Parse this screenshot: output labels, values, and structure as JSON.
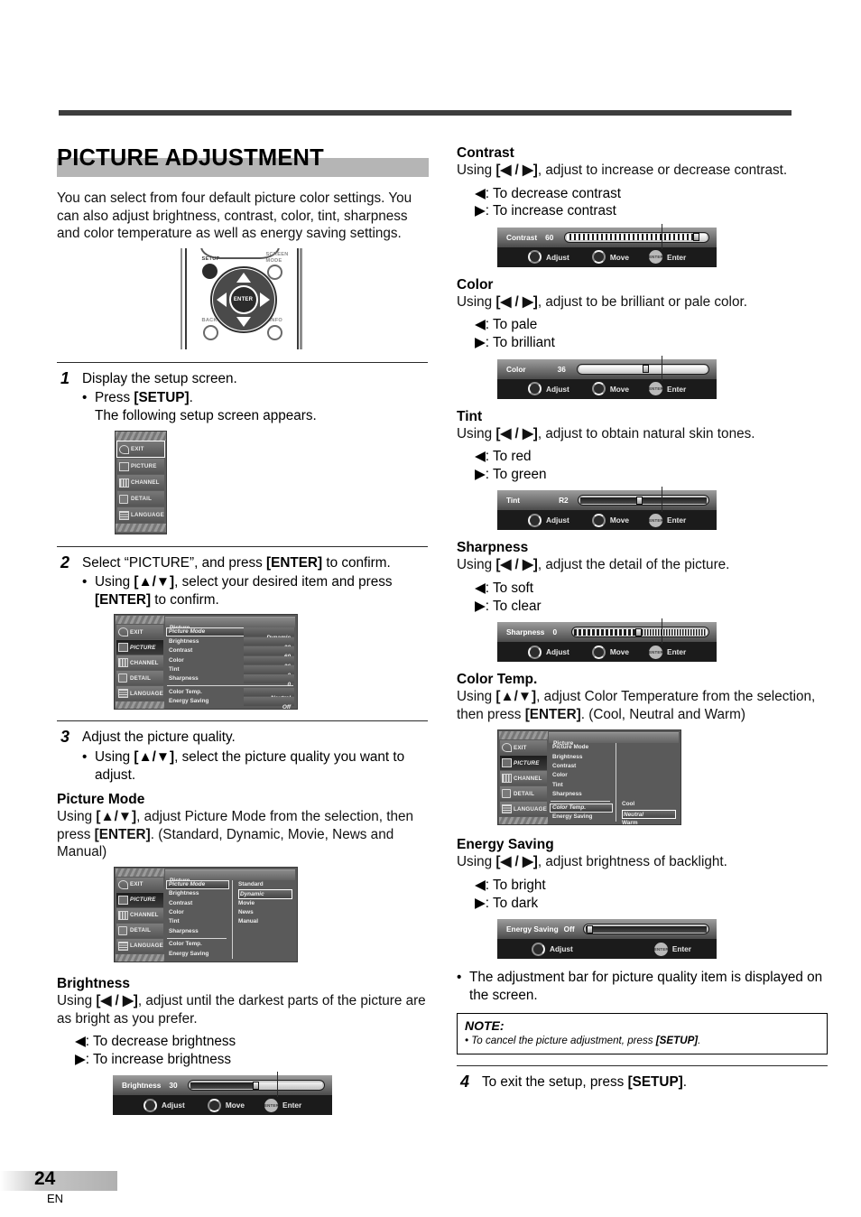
{
  "page": {
    "number": "24",
    "lang_code": "EN"
  },
  "title": "PICTURE ADJUSTMENT",
  "intro": "You can select from four default picture color settings. You can also adjust brightness, contrast, color, tint, sharpness and color temperature as well as energy saving settings.",
  "remote": {
    "setup_label": "SETUP",
    "screen_mode_label_1": "SCREEN",
    "screen_mode_label_2": "MODE",
    "back_label": "BACK",
    "info_label": "INFO",
    "enter_label": "ENTER"
  },
  "steps": [
    {
      "num": "1",
      "text": "Display the setup screen.",
      "bullets": [
        "Press [SETUP].",
        "The following setup screen appears."
      ]
    },
    {
      "num": "2",
      "text": "Select “PICTURE”, and press [ENTER] to confirm.",
      "bullets": [
        "Using [▲/▼], select your desired item and press [ENTER] to confirm."
      ]
    },
    {
      "num": "3",
      "text": "Adjust the picture quality.",
      "bullets": [
        "Using [▲/▼], select the picture quality you want to adjust."
      ]
    },
    {
      "num": "4",
      "text": "To exit the setup, press [SETUP]."
    }
  ],
  "setup_menu": {
    "items": [
      {
        "label": "EXIT",
        "icon": "exit-arrow-icon",
        "selected": true
      },
      {
        "label": "PICTURE",
        "icon": "picture-icon",
        "selected": false
      },
      {
        "label": "CHANNEL",
        "icon": "channel-bars-icon",
        "selected": false
      },
      {
        "label": "DETAIL",
        "icon": "detail-pages-icon",
        "selected": false
      },
      {
        "label": "LANGUAGE",
        "icon": "language-pencil-icon",
        "selected": false
      }
    ]
  },
  "picture_menu": {
    "header": "Picture",
    "rows": [
      {
        "label": "Picture Mode",
        "value": "Dynamic",
        "selected": true
      },
      {
        "label": "Brightness",
        "value": "30",
        "selected": false
      },
      {
        "label": "Contrast",
        "value": "60",
        "selected": false
      },
      {
        "label": "Color",
        "value": "36",
        "selected": false
      },
      {
        "label": "Tint",
        "value": "0",
        "selected": false
      },
      {
        "label": "Sharpness",
        "value": "0",
        "selected": false
      },
      {
        "label": "Color Temp.",
        "value": "Neutral",
        "selected": false
      },
      {
        "label": "Energy Saving",
        "value": "Off",
        "selected": false
      }
    ]
  },
  "picture_mode_menu": {
    "header": "Picture",
    "rows": [
      {
        "label": "Picture Mode",
        "selected": true
      },
      {
        "label": "Brightness",
        "selected": false
      },
      {
        "label": "Contrast",
        "selected": false
      },
      {
        "label": "Color",
        "selected": false
      },
      {
        "label": "Tint",
        "selected": false
      },
      {
        "label": "Sharpness",
        "selected": false
      },
      {
        "label": "Color Temp.",
        "selected": false
      },
      {
        "label": "Energy Saving",
        "selected": false
      }
    ],
    "options": [
      {
        "label": "Standard",
        "selected": false
      },
      {
        "label": "Dynamic",
        "selected": true
      },
      {
        "label": "Movie",
        "selected": false
      },
      {
        "label": "News",
        "selected": false
      },
      {
        "label": "Manual",
        "selected": false
      }
    ]
  },
  "color_temp_menu": {
    "header": "Picture",
    "rows": [
      {
        "label": "Picture Mode",
        "selected": false
      },
      {
        "label": "Brightness",
        "selected": false
      },
      {
        "label": "Contrast",
        "selected": false
      },
      {
        "label": "Color",
        "selected": false
      },
      {
        "label": "Tint",
        "selected": false
      },
      {
        "label": "Sharpness",
        "selected": false
      },
      {
        "label": "Color Temp.",
        "selected": true
      },
      {
        "label": "Energy Saving",
        "selected": false
      }
    ],
    "options": [
      {
        "label": "Cool",
        "selected": false
      },
      {
        "label": "Neutral",
        "selected": true
      },
      {
        "label": "Warm",
        "selected": false
      }
    ]
  },
  "sections": {
    "picture_mode": {
      "heading": "Picture Mode",
      "body": "Using [▲/▼], adjust Picture Mode from the selection, then press [ENTER]. (Standard, Dynamic, Movie, News and Manual)"
    },
    "brightness": {
      "heading": "Brightness",
      "body": "Using [◀ / ▶], adjust until the darkest parts of the picture are as bright as you prefer.",
      "left": "◀: To decrease brightness",
      "right": "▶: To increase brightness"
    },
    "contrast": {
      "heading": "Contrast",
      "body": "Using [◀ / ▶], adjust to increase or decrease contrast.",
      "left": "◀: To decrease contrast",
      "right": "▶: To increase contrast"
    },
    "color": {
      "heading": "Color",
      "body": "Using [◀ / ▶], adjust to be brilliant or pale color.",
      "left": "◀: To pale",
      "right": "▶: To brilliant"
    },
    "tint": {
      "heading": "Tint",
      "body": "Using [◀ / ▶], adjust to obtain natural skin tones.",
      "left": "◀: To red",
      "right": "▶: To green"
    },
    "sharpness": {
      "heading": "Sharpness",
      "body": "Using [◀ / ▶], adjust the detail of the picture.",
      "left": "◀: To soft",
      "right": "▶: To clear"
    },
    "color_temp": {
      "heading": "Color Temp.",
      "body": "Using [▲/▼], adjust Color Temperature from the selection, then press [ENTER]. (Cool, Neutral and Warm)"
    },
    "energy_saving": {
      "heading": "Energy Saving",
      "body": "Using [◀ / ▶], adjust brightness of backlight.",
      "left": "◀: To bright",
      "right": "▶: To dark"
    }
  },
  "osd_bars": {
    "brightness": {
      "name": "Brightness",
      "value": "30",
      "adjust": "Adjust",
      "move": "Move",
      "enter": "Enter",
      "enter_glyph": "ENTER"
    },
    "contrast": {
      "name": "Contrast",
      "value": "60",
      "adjust": "Adjust",
      "move": "Move",
      "enter": "Enter",
      "enter_glyph": "ENTER"
    },
    "color": {
      "name": "Color",
      "value": "36",
      "adjust": "Adjust",
      "move": "Move",
      "enter": "Enter",
      "enter_glyph": "ENTER"
    },
    "tint": {
      "name": "Tint",
      "value": "R2",
      "adjust": "Adjust",
      "move": "Move",
      "enter": "Enter",
      "enter_glyph": "ENTER"
    },
    "sharpness": {
      "name": "Sharpness",
      "value": "0",
      "adjust": "Adjust",
      "move": "Move",
      "enter": "Enter",
      "enter_glyph": "ENTER"
    },
    "energy_saving": {
      "name": "Energy Saving",
      "value": "Off",
      "adjust": "Adjust",
      "enter": "Enter",
      "enter_glyph": "ENTER"
    }
  },
  "final_bullet": "The adjustment bar for picture quality item is displayed on the screen.",
  "note": {
    "heading": "NOTE:",
    "body": "• To cancel the picture adjustment, press [SETUP]."
  }
}
